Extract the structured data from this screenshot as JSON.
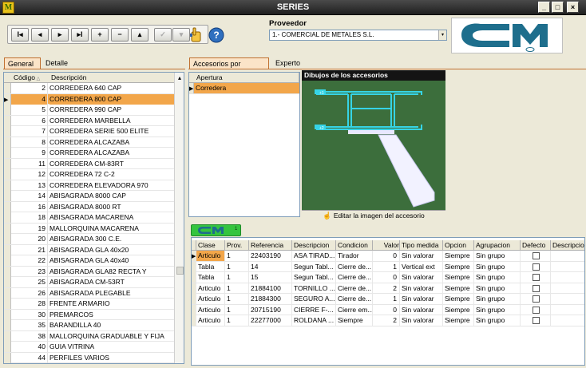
{
  "window": {
    "title": "SERIES",
    "app_icon_letter": "M",
    "buttons": [
      "_",
      "□",
      "×"
    ]
  },
  "toolbar": {
    "nav_buttons": [
      {
        "name": "first",
        "label": "I◂",
        "enabled": true
      },
      {
        "name": "prior",
        "label": "◂",
        "enabled": true
      },
      {
        "name": "next",
        "label": "▸",
        "enabled": true
      },
      {
        "name": "last",
        "label": "▸I",
        "enabled": true
      },
      {
        "name": "insert",
        "label": "+",
        "enabled": true
      },
      {
        "name": "delete",
        "label": "−",
        "enabled": true
      },
      {
        "name": "edit",
        "label": "▴",
        "enabled": true
      },
      {
        "name": "post",
        "label": "✓",
        "enabled": false
      },
      {
        "name": "cancel",
        "label": "▾",
        "enabled": false
      }
    ]
  },
  "proveedor": {
    "label": "Proveedor",
    "value": "1.- COMERCIAL DE METALES S.L."
  },
  "logo": {
    "text": "CM",
    "color": "#1e6e8c"
  },
  "left_tabs": [
    {
      "label": "General",
      "active": true
    },
    {
      "label": "Detalle",
      "active": false
    }
  ],
  "series_grid": {
    "headers": [
      "Código",
      "Descripción"
    ],
    "rows": [
      {
        "codigo": "2",
        "descripcion": "CORREDERA 640 CAP"
      },
      {
        "codigo": "4",
        "descripcion": "CORREDERA 800 CAP",
        "selected": true
      },
      {
        "codigo": "5",
        "descripcion": "CORREDERA 990 CAP"
      },
      {
        "codigo": "6",
        "descripcion": "CORREDERA MARBELLA"
      },
      {
        "codigo": "7",
        "descripcion": "CORREDERA SERIE 500 ELITE"
      },
      {
        "codigo": "8",
        "descripcion": "CORREDERA ALCAZABA"
      },
      {
        "codigo": "9",
        "descripcion": "CORREDERA ALCAZABA"
      },
      {
        "codigo": "11",
        "descripcion": "CORREDERA CM-83RT"
      },
      {
        "codigo": "12",
        "descripcion": "CORREDERA 72 C-2"
      },
      {
        "codigo": "13",
        "descripcion": "CORREDERA ELEVADORA 970"
      },
      {
        "codigo": "14",
        "descripcion": "ABISAGRADA 8000 CAP"
      },
      {
        "codigo": "16",
        "descripcion": "ABISAGRADA 8000 RT"
      },
      {
        "codigo": "18",
        "descripcion": "ABISAGRADA MACARENA"
      },
      {
        "codigo": "19",
        "descripcion": "MALLORQUINA MACARENA"
      },
      {
        "codigo": "20",
        "descripcion": "ABISAGRADA 300 C.E."
      },
      {
        "codigo": "21",
        "descripcion": "ABISAGRADA GLA 40x20"
      },
      {
        "codigo": "22",
        "descripcion": "ABISAGRADA GLA 40x40"
      },
      {
        "codigo": "23",
        "descripcion": "ABISAGRADA GLA82 RECTA Y"
      },
      {
        "codigo": "25",
        "descripcion": "ABISAGRADA CM-53RT"
      },
      {
        "codigo": "26",
        "descripcion": "ABISAGRADA PLEGABLE"
      },
      {
        "codigo": "28",
        "descripcion": "FRENTE ARMARIO"
      },
      {
        "codigo": "30",
        "descripcion": "PREMARCOS"
      },
      {
        "codigo": "35",
        "descripcion": "BARANDILLA 40"
      },
      {
        "codigo": "38",
        "descripcion": "MALLORQUINA GRADUABLE Y FIJA"
      },
      {
        "codigo": "40",
        "descripcion": "GUIA VITRINA"
      },
      {
        "codigo": "44",
        "descripcion": "PERFILES VARIOS"
      }
    ]
  },
  "right_tabs": [
    {
      "label": "Accesorios por apertura",
      "active": true
    },
    {
      "label": "Experto",
      "active": false
    }
  ],
  "apertura_grid": {
    "header": "Apertura",
    "rows": [
      {
        "value": "Corredera",
        "selected": true
      }
    ]
  },
  "drawing": {
    "title": "Dibujos de los accesorios",
    "edit_label": "Editar la imagen del accesorio"
  },
  "accessories_tab": {
    "logo_text": "CM",
    "suffix": "1"
  },
  "accessories_grid": {
    "headers": [
      "Clase",
      "Prov.",
      "Referencia",
      "Descripcion",
      "Condicion",
      "Valor",
      "Tipo medida",
      "Opcion",
      "Agrupacion",
      "Defecto",
      "Descripcio"
    ],
    "rows": [
      {
        "clase": "Articulo",
        "prov": "1",
        "referencia": "22403190",
        "descripcion": "ASA TIRAD...",
        "condicion": "Tirador",
        "valor": "0",
        "tipo_medida": "Sin valorar",
        "opcion": "Siempre",
        "agrupacion": "Sin grupo",
        "selected": true
      },
      {
        "clase": "Tabla",
        "prov": "1",
        "referencia": "14",
        "descripcion": "Segun Tabl...",
        "condicion": "Cierre de...",
        "valor": "1",
        "tipo_medida": "Vertical ext",
        "opcion": "Siempre",
        "agrupacion": "Sin grupo"
      },
      {
        "clase": "Tabla",
        "prov": "1",
        "referencia": "15",
        "descripcion": "Segun Tabl...",
        "condicion": "Cierre de...",
        "valor": "0",
        "tipo_medida": "Sin valorar",
        "opcion": "Siempre",
        "agrupacion": "Sin grupo"
      },
      {
        "clase": "Articulo",
        "prov": "1",
        "referencia": "21884100",
        "descripcion": "TORNILLO ...",
        "condicion": "Cierre de...",
        "valor": "2",
        "tipo_medida": "Sin valorar",
        "opcion": "Siempre",
        "agrupacion": "Sin grupo"
      },
      {
        "clase": "Articulo",
        "prov": "1",
        "referencia": "21884300",
        "descripcion": "SEGURO A...",
        "condicion": "Cierre de...",
        "valor": "1",
        "tipo_medida": "Sin valorar",
        "opcion": "Siempre",
        "agrupacion": "Sin grupo"
      },
      {
        "clase": "Articulo",
        "prov": "1",
        "referencia": "20715190",
        "descripcion": "CIERRE F-...",
        "condicion": "Cierre em...",
        "valor": "0",
        "tipo_medida": "Sin valorar",
        "opcion": "Siempre",
        "agrupacion": "Sin grupo"
      },
      {
        "clase": "Articulo",
        "prov": "1",
        "referencia": "22277000",
        "descripcion": "ROLDANA ...",
        "condicion": "Siempre",
        "valor": "2",
        "tipo_medida": "Sin valorar",
        "opcion": "Siempre",
        "agrupacion": "Sin grupo"
      }
    ]
  }
}
